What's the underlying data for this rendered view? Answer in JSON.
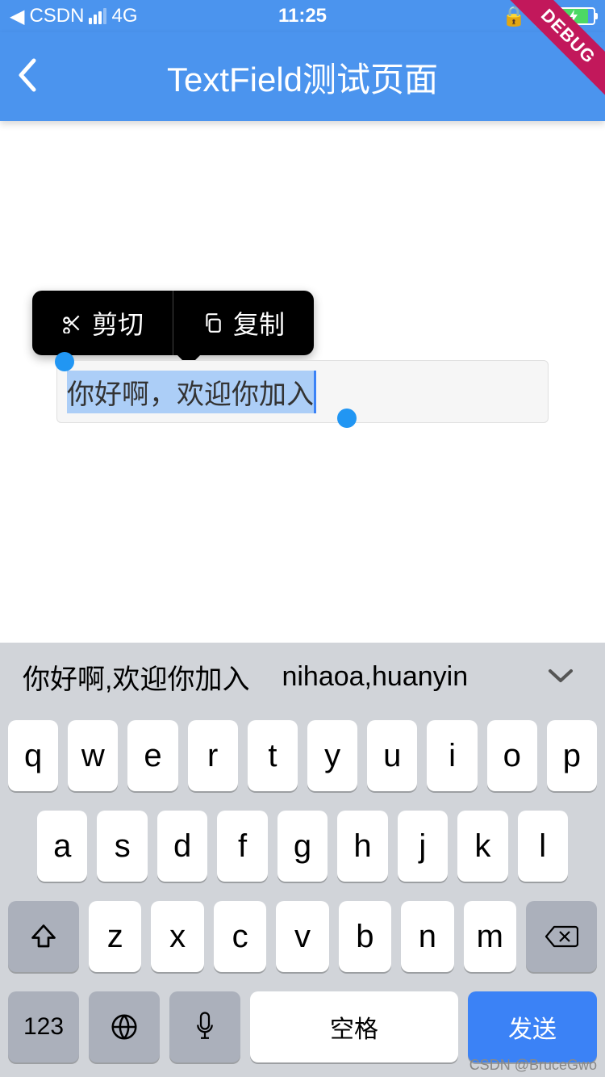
{
  "status_bar": {
    "back_app": "CSDN",
    "network": "4G",
    "time": "11:25"
  },
  "app_bar": {
    "title": "TextField测试页面"
  },
  "debug_ribbon": "DEBUG",
  "context_menu": {
    "cut": "剪切",
    "copy": "复制"
  },
  "text_field": {
    "value": "你好啊，欢迎你加入"
  },
  "keyboard": {
    "candidates": {
      "primary": "你好啊,欢迎你加入",
      "secondary": "nihaoa,huanyin"
    },
    "row1": [
      "q",
      "w",
      "e",
      "r",
      "t",
      "y",
      "u",
      "i",
      "o",
      "p"
    ],
    "row2": [
      "a",
      "s",
      "d",
      "f",
      "g",
      "h",
      "j",
      "k",
      "l"
    ],
    "row3": [
      "z",
      "x",
      "c",
      "v",
      "b",
      "n",
      "m"
    ],
    "numbers_key": "123",
    "space_key": "空格",
    "send_key": "发送"
  },
  "watermark": "CSDN @BruceGwo"
}
